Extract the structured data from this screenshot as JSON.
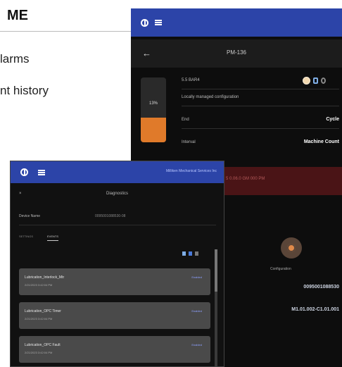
{
  "doc": {
    "title": "ME",
    "line1": "larms",
    "line2": "nt history"
  },
  "tablet_back": {
    "screen_title": "PM-136",
    "gauge_percent": "13%",
    "gauge_fill_fraction": 0.38,
    "rows": [
      {
        "label": "5.5 BAR4",
        "value": ""
      },
      {
        "label": "Locally managed configuration",
        "value": ""
      },
      {
        "label": "End",
        "value": "Cycle"
      },
      {
        "label": "Interval",
        "value": "Machine Count"
      }
    ],
    "red_band_text": "1 5 0.06.0 GM 000 PM",
    "config_label": "Configuration",
    "serial_1": "0095001088530",
    "serial_2": "M1.01.002-C1.01.001"
  },
  "tablet_front": {
    "vendor": "Milliken Mechanical Services Inc",
    "screen_title": "Diagnostics",
    "device_row": {
      "label": "Device Name",
      "value": "0095001088530-08"
    },
    "tabs": [
      "SETTINGS",
      "EVENTS"
    ],
    "cards": [
      {
        "name": "Lubrication_Interlock_Mtr",
        "date": "2/21/2023 3:42:04 PM",
        "status": "Enabled"
      },
      {
        "name": "Lubrication_OPC Timer",
        "date": "2/21/2023 3:42:04 PM",
        "status": "Enabled"
      },
      {
        "name": "Lubrication_OPC Fault",
        "date": "2/21/2023 3:42:04 PM",
        "status": "Enabled"
      }
    ]
  },
  "colors": {
    "appbar": "#2c44a8",
    "gauge": "#e07a2a",
    "alert_band": "#4a1416"
  }
}
